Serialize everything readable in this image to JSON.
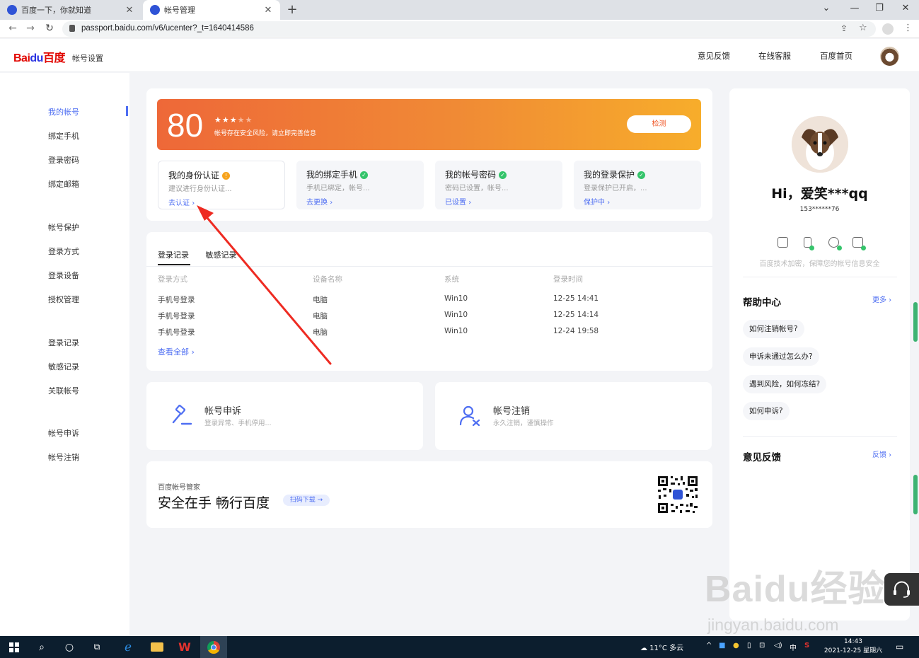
{
  "browser": {
    "tabs": [
      {
        "title": "百度一下，你就知道",
        "close": "✕"
      },
      {
        "title": "帐号管理",
        "close": "✕"
      }
    ],
    "new_tab": "+",
    "url": "passport.baidu.com/v6/ucenter?_t=1640414586",
    "window_controls": {
      "min": "—",
      "max": "❐",
      "close": "✕"
    }
  },
  "header": {
    "logo": "Bai du 百度",
    "subtitle": "帐号设置",
    "nav": [
      "意见反馈",
      "在线客服",
      "百度首页"
    ]
  },
  "sidebar": {
    "groups": [
      [
        "我的帐号",
        "绑定手机",
        "登录密码",
        "绑定邮箱"
      ],
      [
        "帐号保护",
        "登录方式",
        "登录设备",
        "授权管理"
      ],
      [
        "登录记录",
        "敏感记录",
        "关联帐号"
      ],
      [
        "帐号申诉",
        "帐号注销"
      ]
    ],
    "active": "我的帐号"
  },
  "score_banner": {
    "score": "80",
    "stars_filled": 3,
    "stars_total": 5,
    "message": "帐号存在安全风险，请立即完善信息",
    "button": "检测"
  },
  "security_items": [
    {
      "title": "我的身份认证",
      "status": "warn",
      "desc": "建议进行身份认证...",
      "link": "去认证"
    },
    {
      "title": "我的绑定手机",
      "status": "ok",
      "desc": "手机已绑定，帐号...",
      "link": "去更换"
    },
    {
      "title": "我的帐号密码",
      "status": "ok",
      "desc": "密码已设置，帐号...",
      "link": "已设置"
    },
    {
      "title": "我的登录保护",
      "status": "ok",
      "desc": "登录保护已开启，...",
      "link": "保护中"
    }
  ],
  "login_records": {
    "tabs": [
      "登录记录",
      "敏感记录"
    ],
    "columns": [
      "登录方式",
      "设备名称",
      "系统",
      "登录时间"
    ],
    "rows": [
      [
        "手机号登录",
        "电脑",
        "Win10",
        "12-25 14:41"
      ],
      [
        "手机号登录",
        "电脑",
        "Win10",
        "12-25 14:14"
      ],
      [
        "手机号登录",
        "电脑",
        "Win10",
        "12-24 19:58"
      ]
    ],
    "view_all": "查看全部"
  },
  "actions": [
    {
      "title": "帐号申诉",
      "desc": "登录异常、手机停用..."
    },
    {
      "title": "帐号注销",
      "desc": "永久注销，谨慎操作"
    }
  ],
  "promo": {
    "subtitle": "百度帐号管家",
    "title": "安全在手 畅行百度",
    "button": "扫码下载 →"
  },
  "profile": {
    "greeting": "Hi，爱笑***qq",
    "phone": "153******76",
    "safety_note": "百度技术加密，保障您的帐号信息安全"
  },
  "help": {
    "title": "帮助中心",
    "more": "更多",
    "questions": [
      "如何注销帐号?",
      "申诉未通过怎么办?",
      "遇到风险，如何冻结?",
      "如何申诉?"
    ]
  },
  "feedback": {
    "title": "意见反馈",
    "link": "反馈"
  },
  "watermark": {
    "main": "Baidu经验",
    "sub": "jingyan.baidu.com"
  },
  "taskbar": {
    "weather": "11°C 多云",
    "ime": "中",
    "time": "14:43",
    "date": "2021-12-25 星期六"
  },
  "colors": {
    "accent": "#4e6ef2",
    "ok": "#35c46b",
    "warn": "#f7a31c",
    "banner_start": "#ee6838",
    "banner_end": "#f7ad2b",
    "arrow": "#ee2b22"
  }
}
